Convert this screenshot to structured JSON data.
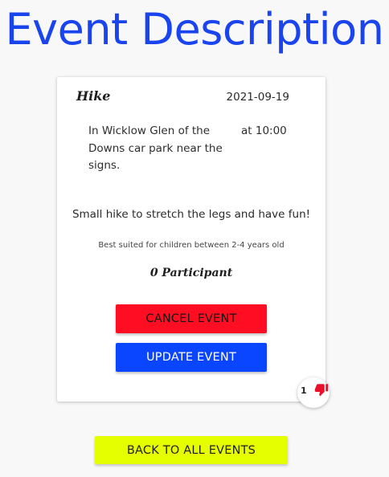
{
  "page": {
    "title": "Event Description"
  },
  "event": {
    "name": "Hike",
    "date": "2021-09-19",
    "location": "In Wicklow Glen of the Downs car park near the signs.",
    "time": "at 10:00",
    "description": "Small hike to stretch the legs and have fun!",
    "audience": "Best suited for children between 2-4 years old",
    "participants": "0 Participant"
  },
  "actions": {
    "cancel_label": "CANCEL EVENT",
    "update_label": "UPDATE EVENT",
    "back_label": "BACK TO ALL EVENTS"
  },
  "vote": {
    "count": "1",
    "icon": "thumbs-down-icon"
  },
  "colors": {
    "title": "#1a44ee",
    "cancel": "#ff0d23",
    "update": "#0a45ff",
    "back": "#e6ff00",
    "thumb": "#e8102a"
  }
}
